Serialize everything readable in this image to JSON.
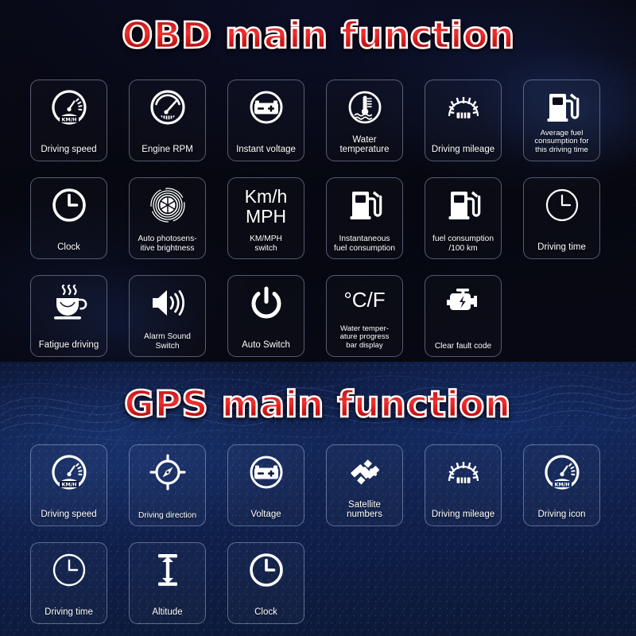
{
  "sections": [
    {
      "id": "obd",
      "title": "OBD main function",
      "rows": [
        [
          {
            "icon": "speedometer-kmh-icon",
            "label": "Driving speed"
          },
          {
            "icon": "tachometer-rpm-icon",
            "label": "Engine RPM"
          },
          {
            "icon": "battery-circle-icon",
            "label": "Instant voltage"
          },
          {
            "icon": "water-temperature-icon",
            "label": "Water\ntemperature"
          },
          {
            "icon": "odometer-icon",
            "label": "Driving mileage"
          },
          {
            "icon": "fuel-pump-icon",
            "label": "Average fuel\nconsumption for\nthis driving time",
            "size": "xs"
          }
        ],
        [
          {
            "icon": "clock-bold-icon",
            "label": "Clock"
          },
          {
            "icon": "aperture-iris-icon",
            "label": "Auto photosens-\nitive brightness",
            "size": "sm"
          },
          {
            "icon": "kmh-mph-text",
            "text": "Km/h\nMPH",
            "label": "KM/MPH\nswitch",
            "size": "sm"
          },
          {
            "icon": "fuel-pump-icon",
            "label": "Instantaneous\nfuel consumption",
            "size": "sm"
          },
          {
            "icon": "fuel-pump-icon",
            "label": "fuel consumption\n/100 km",
            "size": "sm"
          },
          {
            "icon": "clock-thin-icon",
            "label": "Driving time"
          }
        ],
        [
          {
            "icon": "coffee-cup-icon",
            "label": "Fatigue driving"
          },
          {
            "icon": "speaker-sound-icon",
            "label": "Alarm Sound\nSwitch",
            "size": "sm"
          },
          {
            "icon": "power-button-icon",
            "label": "Auto Switch"
          },
          {
            "icon": "celsius-fahrenheit-text",
            "text": "°C/F",
            "label": "Water temper-\nature progress\nbar display",
            "size": "xs"
          },
          {
            "icon": "check-engine-icon",
            "label": "Clear fault code",
            "size": "sm"
          }
        ]
      ]
    },
    {
      "id": "gps",
      "title": "GPS main function",
      "rows": [
        [
          {
            "icon": "speedometer-kmh-icon",
            "label": "Driving speed"
          },
          {
            "icon": "compass-direction-icon",
            "label": "Driving direction",
            "size": "sm"
          },
          {
            "icon": "battery-circle-icon",
            "label": "Voltage"
          },
          {
            "icon": "satellite-icon",
            "label": "Satellite\nnumbers"
          },
          {
            "icon": "odometer-icon",
            "label": "Driving mileage"
          },
          {
            "icon": "speedometer-kmh-icon",
            "label": "Driving icon"
          }
        ],
        [
          {
            "icon": "clock-thin-icon",
            "label": "Driving time"
          },
          {
            "icon": "altitude-arrow-icon",
            "label": "Altitude"
          },
          {
            "icon": "clock-bold-icon",
            "label": "Clock"
          }
        ]
      ]
    }
  ],
  "colors": {
    "title_red": "#e02020",
    "title_outline": "#ffffff",
    "obd_background": "#070814",
    "gps_background": "#112453",
    "icon_white": "#ffffff",
    "card_border": "rgba(190,205,235,0.42)"
  }
}
